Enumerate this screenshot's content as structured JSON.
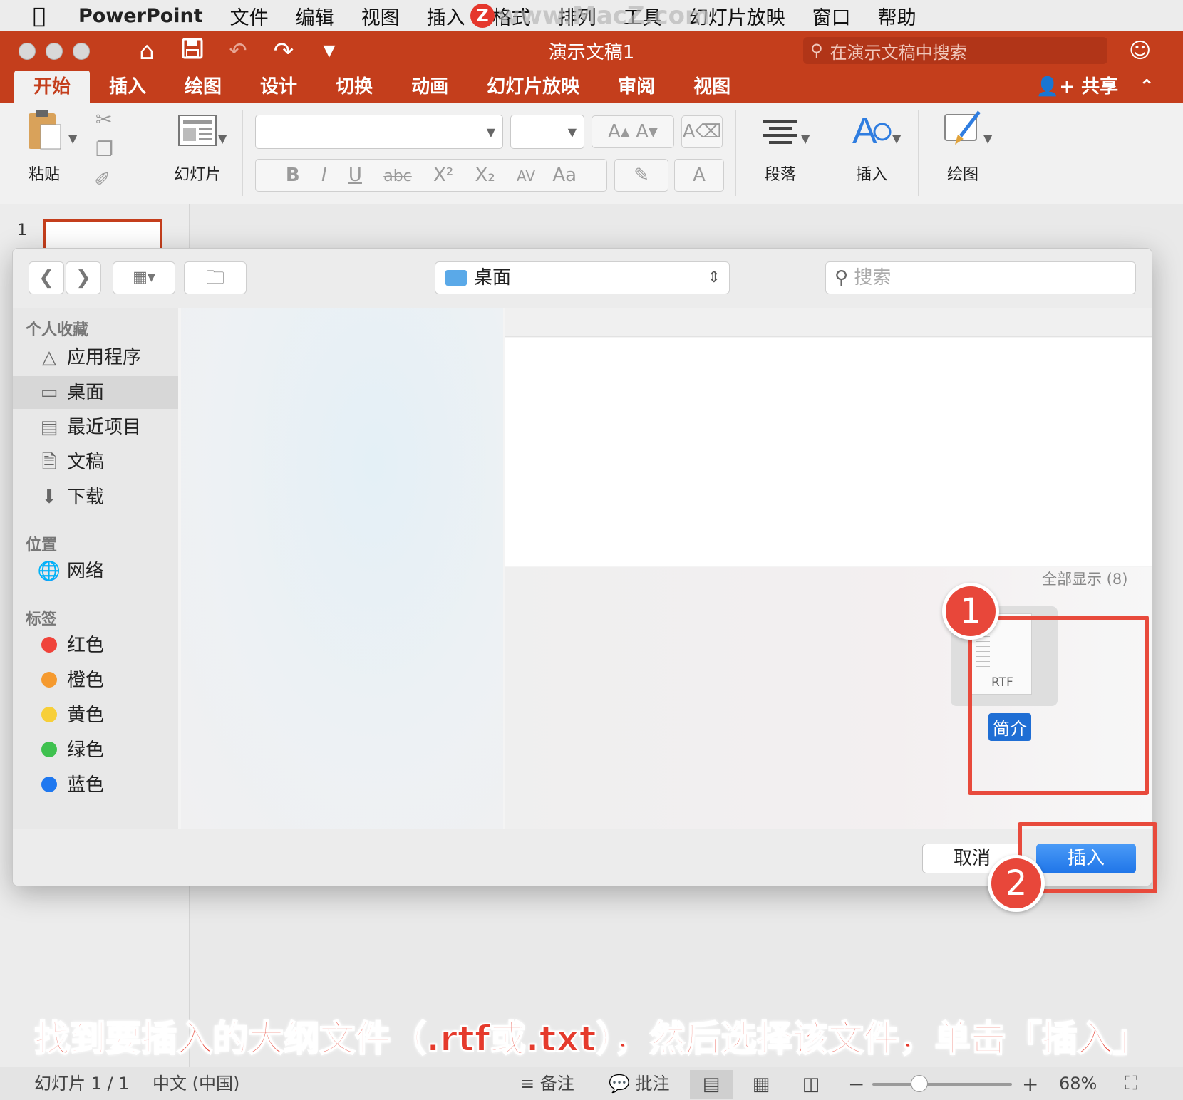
{
  "menubar": {
    "app_name": "PowerPoint",
    "items": [
      "文件",
      "编辑",
      "视图",
      "插入",
      "格式",
      "排列",
      "工具",
      "幻灯片放映",
      "窗口",
      "帮助"
    ],
    "watermark": "www.MacZ.com"
  },
  "titlebar": {
    "document_title": "演示文稿1",
    "search_placeholder": "在演示文稿中搜索"
  },
  "ribbon_tabs": {
    "tabs": [
      "开始",
      "插入",
      "绘图",
      "设计",
      "切换",
      "动画",
      "幻灯片放映",
      "审阅",
      "视图"
    ],
    "active": "开始",
    "share_label": "共享"
  },
  "ribbon": {
    "paste_label": "粘贴",
    "slides_label": "幻灯片",
    "paragraph_label": "段落",
    "insert_label": "插入",
    "drawing_label": "绘图"
  },
  "slide_panel": {
    "slide_number": "1"
  },
  "dialog": {
    "location": "桌面",
    "search_placeholder": "搜索",
    "sidebar": {
      "favorites_header": "个人收藏",
      "favorites": [
        "应用程序",
        "桌面",
        "最近项目",
        "文稿",
        "下载"
      ],
      "selected": "桌面",
      "locations_header": "位置",
      "locations": [
        "网络"
      ],
      "tags_header": "标签",
      "tags": [
        {
          "label": "红色",
          "color": "#f0433a"
        },
        {
          "label": "橙色",
          "color": "#f59a2f"
        },
        {
          "label": "黄色",
          "color": "#f7cf38"
        },
        {
          "label": "绿色",
          "color": "#3fc14f"
        },
        {
          "label": "蓝色",
          "color": "#1f78f0"
        }
      ]
    },
    "show_all": "全部显示 (8)",
    "file": {
      "name": "简介",
      "type_label": "RTF"
    },
    "cancel_label": "取消",
    "insert_label": "插入"
  },
  "annotations": {
    "step1": "1",
    "step2": "2",
    "accent_color": "#e84a3c",
    "caption": "找到要插入的大纲文件（.rtf或.txt），然后选择该文件，单击「插入」"
  },
  "statusbar": {
    "slide_info": "幻灯片 1 / 1",
    "language": "中文 (中国)",
    "notes_label": "备注",
    "comments_label": "批注",
    "zoom": "68%"
  }
}
